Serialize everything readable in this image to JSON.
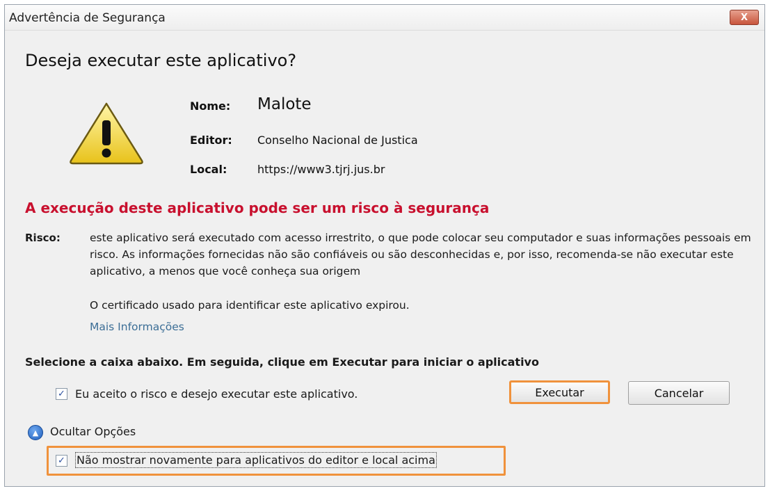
{
  "window": {
    "title": "Advertência de Segurança",
    "close_label": "X"
  },
  "dialog": {
    "heading": "Deseja executar este aplicativo?",
    "icon": "warning-triangle-icon",
    "details": {
      "name_label": "Nome:",
      "name_value": "Malote",
      "publisher_label": "Editor:",
      "publisher_value": "Conselho Nacional de Justica",
      "location_label": "Local:",
      "location_value": "https://www3.tjrj.jus.br"
    },
    "risk_title": "A execução deste aplicativo pode ser um risco à segurança",
    "risk_label": "Risco:",
    "risk_text": "este aplicativo será executado com acesso irrestrito, o que pode colocar seu computador e suas informações pessoais em risco. As informações fornecidas não são confiáveis ou são desconhecidas e, por isso, recomenda-se não executar este aplicativo, a menos que você conheça sua origem",
    "certificate_text": "O certificado usado para identificar este aplicativo expirou.",
    "more_info_link": "Mais Informações",
    "instruction": "Selecione a caixa abaixo. Em seguida, clique em Executar para iniciar o aplicativo",
    "accept_checkbox_label": "Eu aceito o risco e desejo executar este aplicativo.",
    "accept_checked": true,
    "run_button": "Executar",
    "cancel_button": "Cancelar",
    "options_toggle": "Ocultar Opções",
    "dont_show_checkbox_label": "Não mostrar novamente para aplicativos do editor e local acima",
    "dont_show_checked": true
  },
  "colors": {
    "risk_red": "#c8102e",
    "link_blue": "#3c6e96",
    "highlight_orange": "#f0923c",
    "close_red": "#c8553c"
  }
}
